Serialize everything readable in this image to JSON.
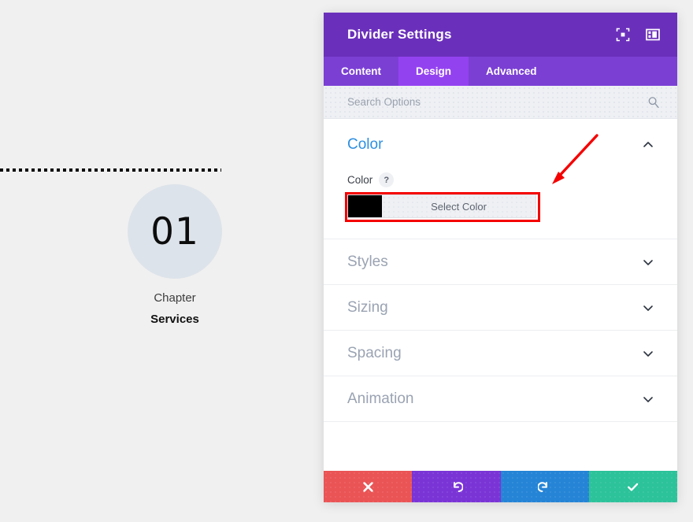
{
  "preview": {
    "divider": {
      "style": "dotted",
      "color": "#000000"
    },
    "number": "01",
    "chapter_label": "Chapter",
    "chapter_title": "Services",
    "circle_color": "#dde3ea",
    "background": "#f0f0f0"
  },
  "modal": {
    "title": "Divider Settings",
    "header_icons": [
      {
        "name": "focus-target-icon"
      },
      {
        "name": "layout-panel-icon"
      }
    ],
    "tabs": [
      {
        "label": "Content",
        "active": false
      },
      {
        "label": "Design",
        "active": true
      },
      {
        "label": "Advanced",
        "active": false
      }
    ],
    "search": {
      "placeholder": "Search Options",
      "value": ""
    },
    "open_section": {
      "title": "Color",
      "title_color": "#2e8fe0",
      "chevron": "up",
      "field": {
        "label": "Color",
        "help": "?",
        "swatch_color": "#000000",
        "button_label": "Select Color"
      }
    },
    "collapsed_sections": [
      {
        "title": "Styles",
        "chevron": "down"
      },
      {
        "title": "Sizing",
        "chevron": "down"
      },
      {
        "title": "Spacing",
        "chevron": "down"
      },
      {
        "title": "Animation",
        "chevron": "down"
      }
    ],
    "actions": [
      {
        "name": "cancel",
        "icon": "close-icon",
        "color": "#ea5455"
      },
      {
        "name": "undo",
        "icon": "undo-icon",
        "color": "#7a34d6"
      },
      {
        "name": "redo",
        "icon": "redo-icon",
        "color": "#2584d6"
      },
      {
        "name": "save",
        "icon": "check-icon",
        "color": "#2cc29a"
      }
    ]
  },
  "annotation": {
    "arrow_color": "#f50000",
    "highlight_color": "#f50000"
  }
}
